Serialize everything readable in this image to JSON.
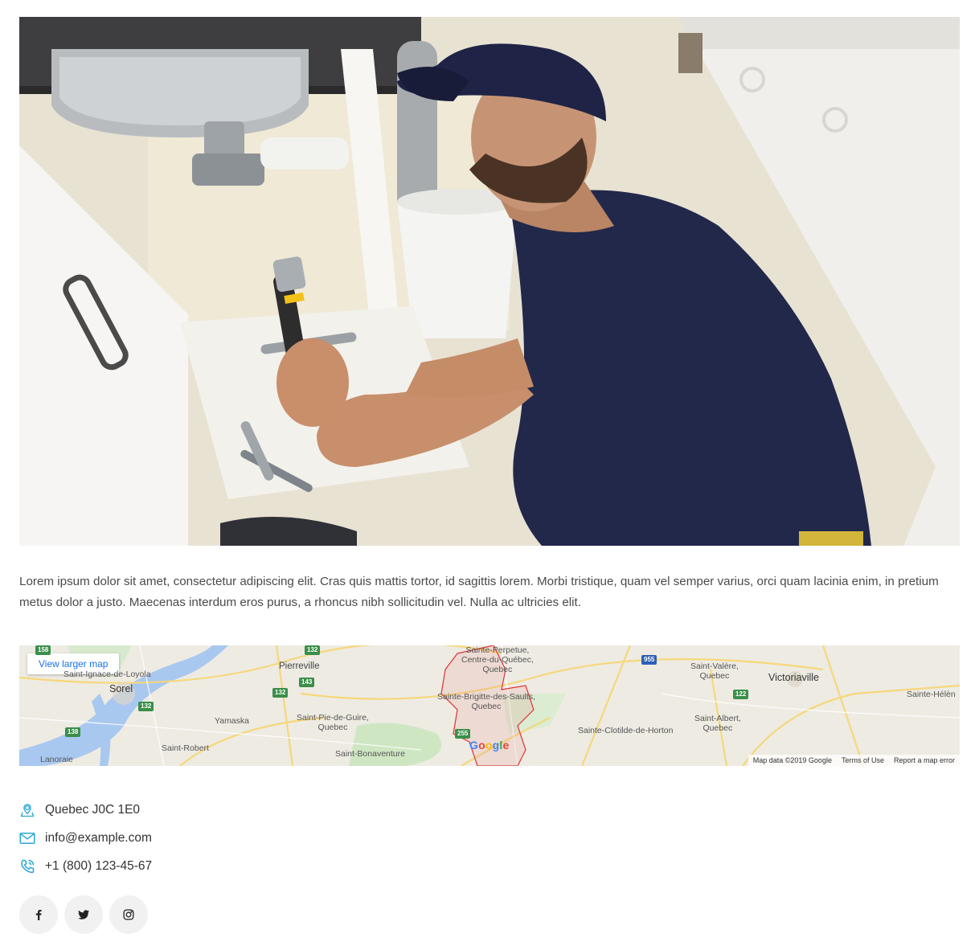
{
  "hero": {
    "alt": "Plumber repairing sink pipes under a kitchen cabinet"
  },
  "description": "Lorem ipsum dolor sit amet, consectetur adipiscing elit. Cras quis mattis tortor, id sagittis lorem. Morbi tristique, quam vel semper varius, orci quam lacinia enim, in pretium metus dolor a justo. Maecenas interdum eros purus, a rhoncus nibh sollicitudin vel. Nulla ac ultricies elit.",
  "map": {
    "view_larger": "View larger map",
    "labels": {
      "pierreville": "Pierreville",
      "sorel": "Sorel",
      "st_ignace": "Saint-Ignace-de-Loyola",
      "yamaska": "Yamaska",
      "st_pie": "Saint-Pie-de-Guire,\nQuebec",
      "st_robert": "Saint-Robert",
      "st_bonaventure": "Saint-Bonaventure",
      "lanoraie": "Lanoraie",
      "st_perpetue": "Sainte-Perpetue,\nCentre-du-Québec,\nQuebec",
      "st_brigitte": "Sainte-Brigitte-des-Saults,\nQuebec",
      "st_clotilde": "Sainte-Clotilde-de-Horton",
      "st_valere": "Saint-Valère,\nQuebec",
      "victoriaville": "Victoriaville",
      "st_albert": "Saint-Albert,\nQuebec",
      "st_helene": "Sainte-Hélèn"
    },
    "shields": [
      "158",
      "132",
      "143",
      "132",
      "132",
      "138",
      "255",
      "955",
      "122"
    ],
    "google": "Google",
    "map_data": "Map data ©2019 Google",
    "terms": "Terms of Use",
    "report": "Report a map error"
  },
  "contact": {
    "address": "Quebec J0C 1E0",
    "email": "info@example.com",
    "phone": "+1 (800) 123-45-67"
  },
  "social": [
    "facebook-icon",
    "twitter-icon",
    "instagram-icon"
  ],
  "colors": {
    "accent": "#2aa7d6",
    "icon_bg": "#f1f1f1"
  }
}
